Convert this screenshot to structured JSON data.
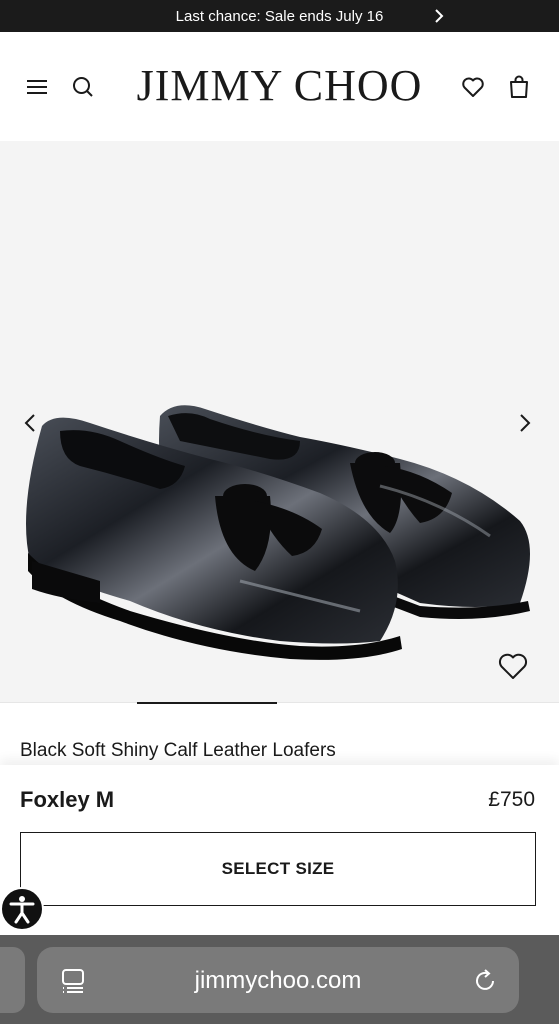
{
  "announcement": {
    "text": "Last chance: Sale ends July 16"
  },
  "header": {
    "logo": "JIMMY CHOO"
  },
  "hero": {
    "image_alt": "Black patent leather loafers with tassels"
  },
  "product": {
    "name": "Black Soft Shiny Calf Leather Loafers",
    "collection": "Foxley M",
    "price": "£750",
    "cta_label": "SELECT SIZE"
  },
  "browser": {
    "url": "jimmychoo.com"
  },
  "icons": {
    "menu": "hamburger-menu-icon",
    "search": "search-icon",
    "wishlist": "heart-icon",
    "bag": "shopping-bag-icon",
    "prev": "chevron-left-icon",
    "next": "chevron-right-icon",
    "announce_next": "chevron-right-icon",
    "accessibility": "accessibility-icon",
    "reader": "reader-mode-icon",
    "reload": "reload-icon"
  },
  "colors": {
    "bar": "#1b1b1b",
    "hero_bg": "#f4f4f4",
    "browser_bg": "#5b5b5b",
    "text": "#1a1a1a"
  },
  "gallery": {
    "progress_fraction": 0.25
  }
}
